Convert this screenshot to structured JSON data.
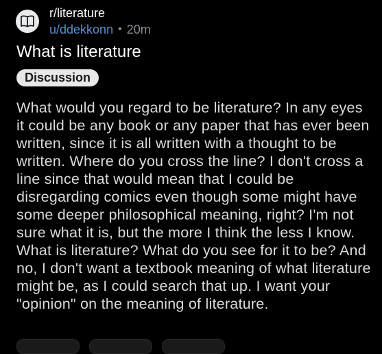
{
  "post": {
    "subreddit": "r/literature",
    "author": "u/ddekkonn",
    "separator": "•",
    "time_ago": "20m",
    "title": "What is literature",
    "flair": "Discussion",
    "body": "What would you regard to be literature? In any eyes it could be any book or any paper that has ever been written, since it is all written with a thought to be written. Where do you cross the line? I don't cross a line since that would mean that I could be disregarding comics even though some might have some deeper philosophical meaning, right? I'm not sure what it is, but the more I think the less I know. What is literature? What do you see for it to be? And no, I don't want a textbook meaning of what literature might be, as I could search that up. I want your \"opinion\" on the meaning of literature."
  },
  "icons": {
    "subreddit_avatar": "book-icon"
  },
  "colors": {
    "background": "#000000",
    "text": "#d7dadc",
    "username": "#5b8fd3",
    "flair_bg": "#e8e8e8"
  }
}
